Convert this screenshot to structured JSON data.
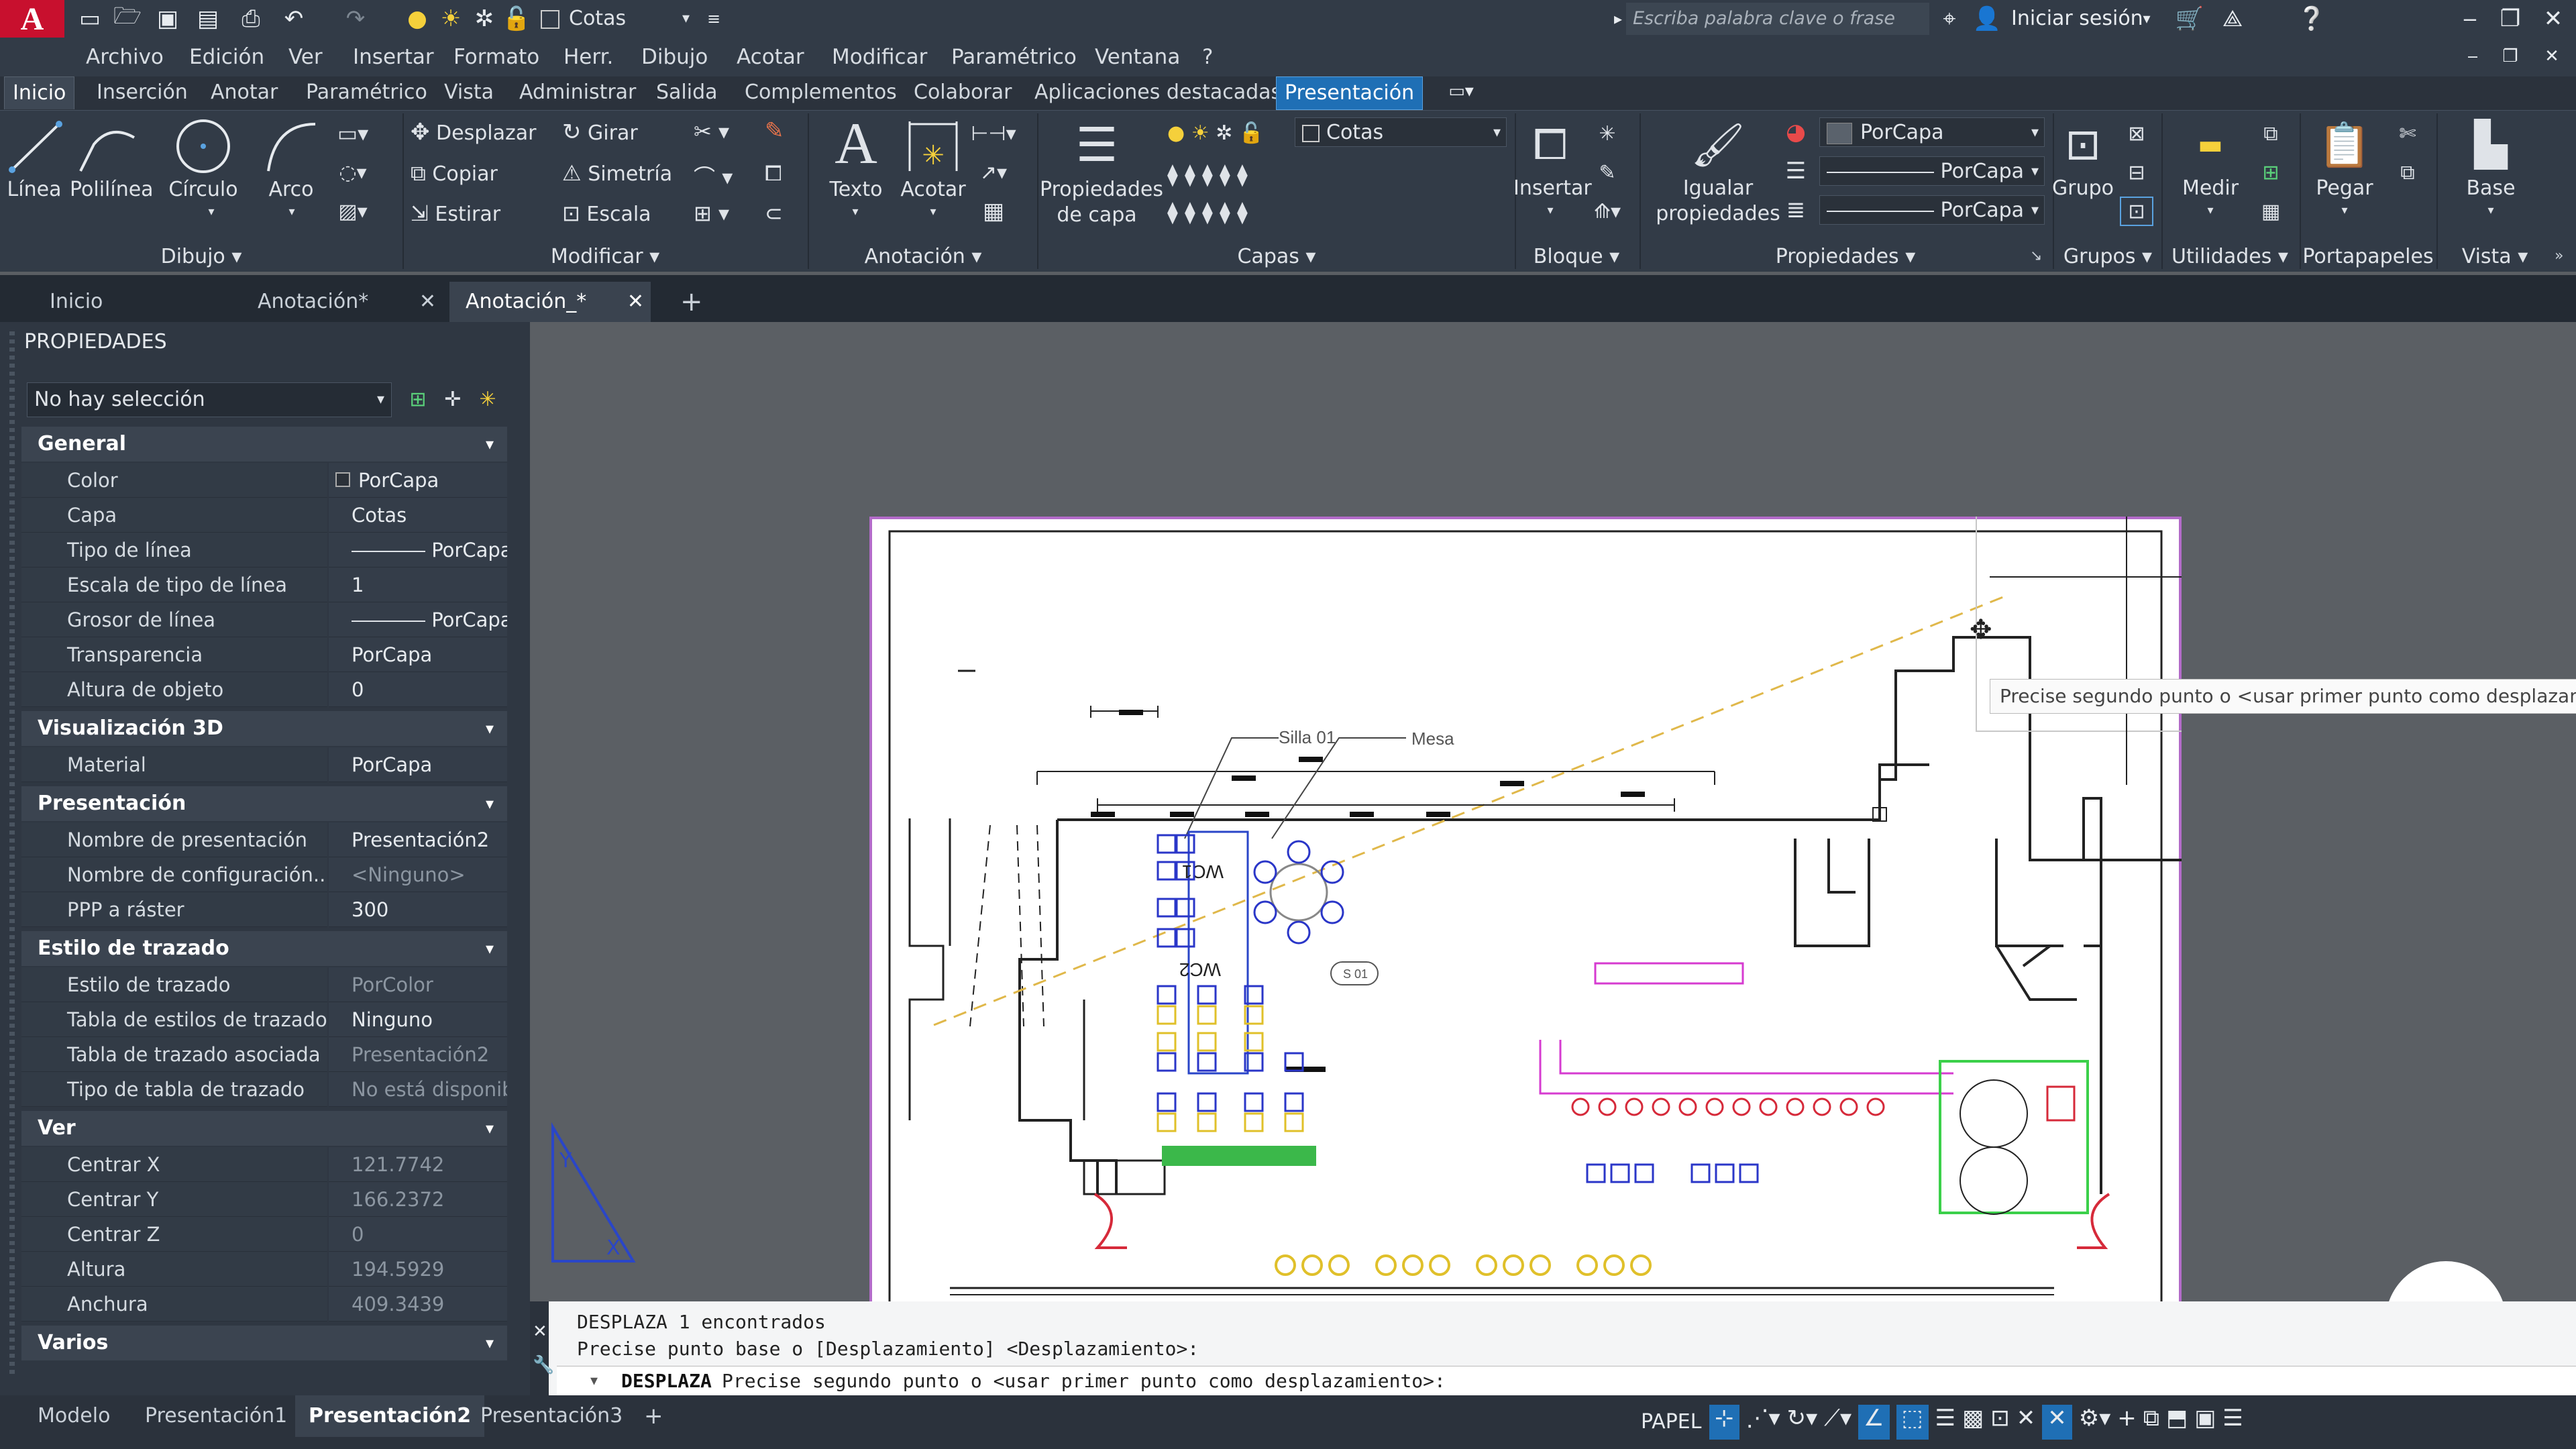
{
  "app": {
    "logo_letter": "A"
  },
  "qat": {
    "layer_name": "Cotas",
    "search_placeholder": "Escriba palabra clave o frase",
    "signin": "Iniciar sesión"
  },
  "menu": [
    "Archivo",
    "Edición",
    "Ver",
    "Insertar",
    "Formato",
    "Herr.",
    "Dibujo",
    "Acotar",
    "Modificar",
    "Paramétrico",
    "Ventana",
    "?"
  ],
  "ribbon_tabs": [
    "Inicio",
    "Inserción",
    "Anotar",
    "Paramétrico",
    "Vista",
    "Administrar",
    "Salida",
    "Complementos",
    "Colaborar",
    "Aplicaciones destacadas",
    "Presentación"
  ],
  "ribbon": {
    "dibujo": {
      "title": "Dibujo",
      "linea": "Línea",
      "polilinea": "Polilínea",
      "circulo": "Círculo",
      "arco": "Arco"
    },
    "modificar": {
      "title": "Modificar",
      "desplazar": "Desplazar",
      "girar": "Girar",
      "copiar": "Copiar",
      "simetria": "Simetría",
      "estirar": "Estirar",
      "escala": "Escala"
    },
    "anotacion": {
      "title": "Anotación",
      "texto": "Texto",
      "acotar": "Acotar"
    },
    "capas": {
      "title": "Capas",
      "propiedades_l1": "Propiedades",
      "propiedades_l2": "de capa",
      "layer": "Cotas"
    },
    "bloque": {
      "title": "Bloque",
      "insertar": "Insertar"
    },
    "propiedades": {
      "title": "Propiedades",
      "igualar_l1": "Igualar",
      "igualar_l2": "propiedades",
      "color": "PorCapa",
      "linetype": "PorCapa",
      "lineweight": "PorCapa"
    },
    "grupos": {
      "title": "Grupos",
      "grupo": "Grupo"
    },
    "utilidades": {
      "title": "Utilidades",
      "medir": "Medir"
    },
    "portapapeles": {
      "title": "Portapapeles",
      "pegar": "Pegar"
    },
    "vista": {
      "title": "Vista",
      "base": "Base"
    }
  },
  "doc_tabs": [
    "Inicio",
    "Anotación*",
    "Anotación_*"
  ],
  "properties": {
    "title": "PROPIEDADES",
    "selection": "No hay selección",
    "sections": {
      "general": {
        "title": "General",
        "rows": [
          {
            "k": "Color",
            "v": "PorCapa"
          },
          {
            "k": "Capa",
            "v": "Cotas"
          },
          {
            "k": "Tipo de línea",
            "v": "PorCapa"
          },
          {
            "k": "Escala de tipo de línea",
            "v": "1"
          },
          {
            "k": "Grosor de línea",
            "v": "PorCapa"
          },
          {
            "k": "Transparencia",
            "v": "PorCapa"
          },
          {
            "k": "Altura de objeto",
            "v": "0"
          }
        ]
      },
      "vis3d": {
        "title": "Visualización 3D",
        "rows": [
          {
            "k": "Material",
            "v": "PorCapa"
          }
        ]
      },
      "presentacion": {
        "title": "Presentación",
        "rows": [
          {
            "k": "Nombre de presentación",
            "v": "Presentación2"
          },
          {
            "k": "Nombre de configuración...",
            "v": "<Ninguno>"
          },
          {
            "k": "PPP a ráster",
            "v": "300"
          }
        ]
      },
      "estilo": {
        "title": "Estilo de trazado",
        "rows": [
          {
            "k": "Estilo de trazado",
            "v": "PorColor"
          },
          {
            "k": "Tabla de estilos de trazado",
            "v": "Ninguno"
          },
          {
            "k": "Tabla de trazado asociada a",
            "v": "Presentación2"
          },
          {
            "k": "Tipo de tabla de trazado",
            "v": "No está disponible"
          }
        ]
      },
      "ver": {
        "title": "Ver",
        "rows": [
          {
            "k": "Centrar X",
            "v": "121.7742"
          },
          {
            "k": "Centrar Y",
            "v": "166.2372"
          },
          {
            "k": "Centrar Z",
            "v": "0"
          },
          {
            "k": "Altura",
            "v": "194.5929"
          },
          {
            "k": "Anchura",
            "v": "409.3439"
          }
        ]
      },
      "varios": {
        "title": "Varios"
      }
    }
  },
  "drawing": {
    "tooltip": "Precise segundo punto o <usar primer punto como desplazamiento>",
    "label_silla": "Silla 01",
    "label_mesa": "Mesa",
    "label_wc1": "WC1",
    "label_wc2": "WC2",
    "label_s01": "S 01"
  },
  "command": {
    "line1": "DESPLAZA 1 encontrados",
    "line2": "Precise punto base o [Desplazamiento] <Desplazamiento>:",
    "prompt_cmd": "DESPLAZA",
    "prompt_text": "Precise segundo punto o <usar primer punto como desplazamiento>:"
  },
  "layout_tabs": [
    "Modelo",
    "Presentación1",
    "Presentación2",
    "Presentación3"
  ],
  "status": {
    "space": "PAPEL"
  }
}
